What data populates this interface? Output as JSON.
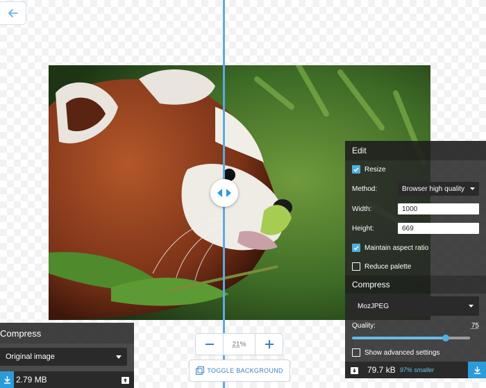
{
  "colors": {
    "accent": "#2c9bd9",
    "divider": "#5fa9df",
    "panel": "#262626"
  },
  "zoom": {
    "value": "21",
    "unit": "%",
    "minus_icon": "minus-icon",
    "plus_icon": "plus-icon"
  },
  "toggle_background": {
    "label": "TOGGLE BACKGROUND"
  },
  "left_panel": {
    "title": "Compress",
    "codec": "Original image",
    "size": "2.79 MB"
  },
  "right_panel": {
    "edit_title": "Edit",
    "resize_label": "Resize",
    "resize_checked": true,
    "method_label": "Method:",
    "method_value": "Browser high quality",
    "width_label": "Width:",
    "width_value": "1000",
    "height_label": "Height:",
    "height_value": "669",
    "aspect_label": "Maintain aspect ratio",
    "aspect_checked": true,
    "palette_label": "Reduce palette",
    "palette_checked": false,
    "compress_title": "Compress",
    "codec": "MozJPEG",
    "quality_label": "Quality:",
    "quality_value": "75",
    "advanced_label": "Show advanced settings",
    "advanced_checked": false,
    "size": "79.7 kB",
    "savings": "97% smaller"
  }
}
